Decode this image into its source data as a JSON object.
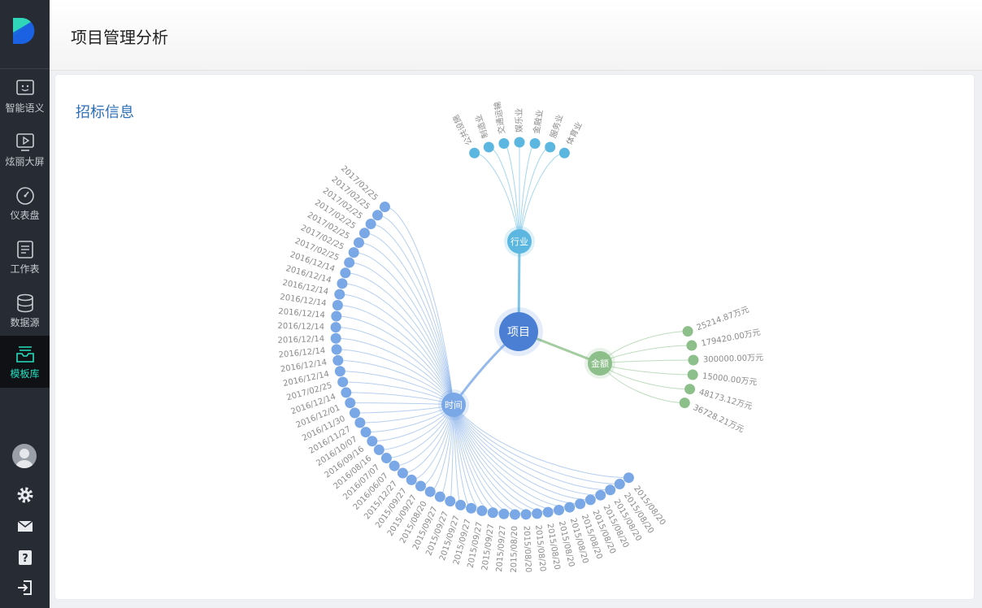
{
  "app": {
    "page_title": "项目管理分析"
  },
  "sidebar": {
    "items": [
      {
        "label": "智能语义",
        "icon": "chat-face-icon"
      },
      {
        "label": "炫丽大屏",
        "icon": "play-screen-icon"
      },
      {
        "label": "仪表盘",
        "icon": "gauge-icon"
      },
      {
        "label": "工作表",
        "icon": "worksheet-icon"
      },
      {
        "label": "数据源",
        "icon": "database-icon"
      },
      {
        "label": "模板库",
        "icon": "template-tray-icon",
        "active": true
      }
    ],
    "bottom_icons": [
      "avatar",
      "settings-gear-icon",
      "mail-icon",
      "help-icon",
      "logout-icon"
    ],
    "active_color": "#25e0c0"
  },
  "card": {
    "title": "招标信息"
  },
  "chart_data": {
    "type": "radial-tree",
    "root": {
      "label": "项目",
      "color": "#4a7fd4"
    },
    "branches": [
      {
        "label": "行业",
        "color": "#5bb7e0",
        "leaves": [
          "公共设施",
          "制造业",
          "交通运输",
          "娱乐业",
          "金融业",
          "服务业",
          "体育业"
        ]
      },
      {
        "label": "金额",
        "color": "#8dbf8a",
        "leaves": [
          "25214.87万元",
          "179420.00万元",
          "300000.00万元",
          "15000.00万元",
          "48173.12万元",
          "36728.21万元"
        ]
      },
      {
        "label": "时间",
        "color": "#7aa7e6",
        "leaves": [
          "2017/02/25",
          "2017/02/25",
          "2017/02/25",
          "2017/02/25",
          "2017/02/25",
          "2017/02/25",
          "2017/02/25",
          "2016/12/14",
          "2016/12/14",
          "2016/12/14",
          "2016/12/14",
          "2016/12/14",
          "2016/12/14",
          "2016/12/14",
          "2016/12/14",
          "2016/12/14",
          "2016/12/14",
          "2017/02/25",
          "2016/12/14",
          "2016/12/01",
          "2016/11/30",
          "2016/11/27",
          "2016/10/07",
          "2016/09/16",
          "2016/08/16",
          "2016/07/07",
          "2016/06/07",
          "2015/12/27",
          "2015/09/27",
          "2015/09/27",
          "2015/08/20",
          "2015/09/27",
          "2015/09/27",
          "2015/09/27",
          "2015/09/27",
          "2015/09/27",
          "2015/09/27",
          "2015/09/27",
          "2015/08/20",
          "2015/08/20",
          "2015/08/20",
          "2015/08/20",
          "2015/08/20",
          "2015/08/20",
          "2015/08/20",
          "2015/08/20",
          "2015/08/20",
          "2015/08/20",
          "2015/08/20",
          "2015/08/20"
        ]
      }
    ]
  }
}
